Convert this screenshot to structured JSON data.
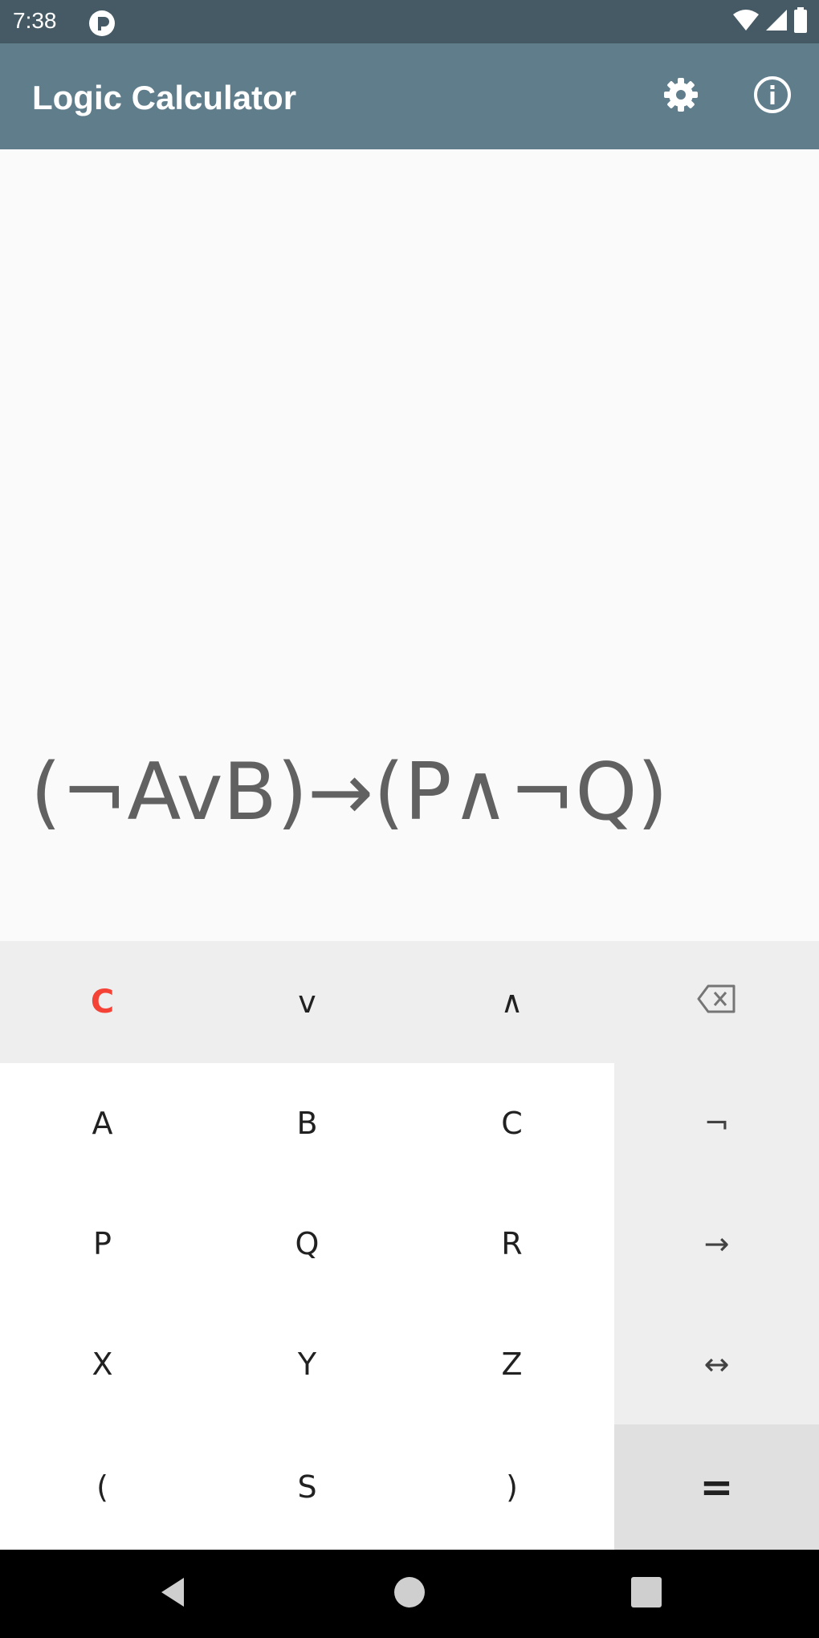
{
  "status_bar": {
    "time": "7:38",
    "icons": [
      "app-notification-icon",
      "wifi-icon",
      "signal-icon",
      "battery-icon"
    ]
  },
  "app_bar": {
    "title": "Logic Calculator",
    "actions": [
      "settings-icon",
      "info-icon"
    ]
  },
  "display": {
    "expression": "(¬AvB)→(P∧¬Q)"
  },
  "keypad": {
    "clear": "C",
    "or": "v",
    "and": "∧",
    "backspace_icon": "backspace-icon",
    "vars_row1": [
      "A",
      "B",
      "C"
    ],
    "vars_row2": [
      "P",
      "Q",
      "R"
    ],
    "vars_row3": [
      "X",
      "Y",
      "Z"
    ],
    "paren_open": "(",
    "s_key": "S",
    "paren_close": ")",
    "not": "¬",
    "implies": "→",
    "iff": "↔",
    "equals": "="
  },
  "colors": {
    "status_bar": "#455a64",
    "app_bar": "#607d8b",
    "clear_key": "#f44336",
    "keypad_gray": "#eeeeee"
  },
  "nav_bar": {
    "buttons": [
      "back-icon",
      "home-icon",
      "recents-icon"
    ]
  }
}
